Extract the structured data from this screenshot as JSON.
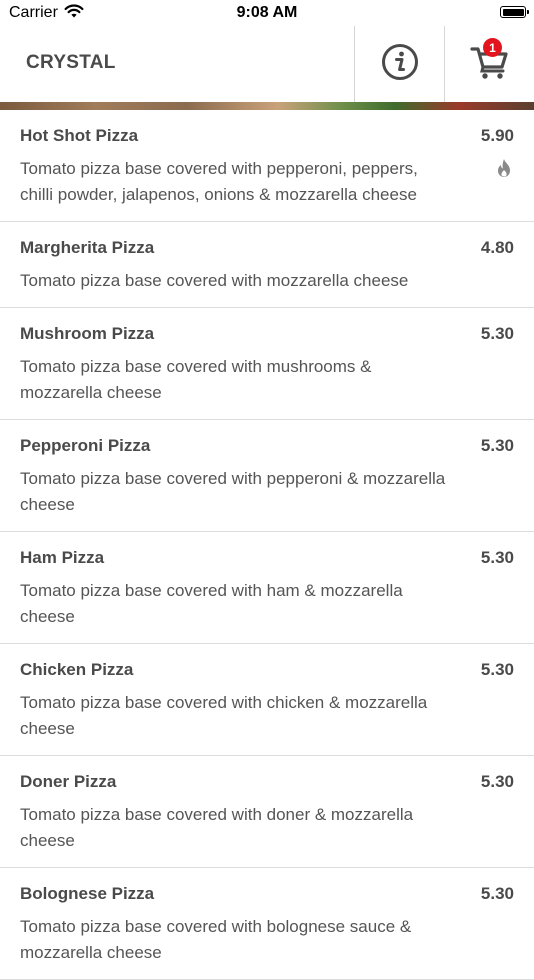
{
  "status_bar": {
    "carrier": "Carrier",
    "time": "9:08 AM"
  },
  "header": {
    "title": "CRYSTAL",
    "cart_count": "1",
    "info_icon": "info-circle-icon",
    "cart_icon": "shopping-cart-icon"
  },
  "colors": {
    "badge": "#e3141e",
    "text": "#4a4a4a",
    "divider": "#dcdcdc"
  },
  "items": [
    {
      "name": "Hot Shot Pizza",
      "price": "5.90",
      "description": "Tomato pizza base covered with pepperoni, peppers, chilli powder, jalapenos, onions & mozzarella cheese",
      "icon": "flame-icon"
    },
    {
      "name": "Margherita Pizza",
      "price": "4.80",
      "description": "Tomato pizza base covered with mozzarella cheese"
    },
    {
      "name": "Mushroom Pizza",
      "price": "5.30",
      "description": "Tomato pizza base covered with mushrooms & mozzarella cheese"
    },
    {
      "name": "Pepperoni Pizza",
      "price": "5.30",
      "description": "Tomato pizza base covered with pepperoni & mozzarella cheese"
    },
    {
      "name": "Ham Pizza",
      "price": "5.30",
      "description": "Tomato pizza base covered with ham & mozzarella cheese"
    },
    {
      "name": "Chicken Pizza",
      "price": "5.30",
      "description": "Tomato pizza base covered with chicken & mozzarella cheese"
    },
    {
      "name": "Doner Pizza",
      "price": "5.30",
      "description": "Tomato pizza base covered with doner & mozzarella cheese"
    },
    {
      "name": "Bolognese Pizza",
      "price": "5.30",
      "description": "Tomato pizza base covered with bolognese sauce & mozzarella cheese"
    }
  ]
}
